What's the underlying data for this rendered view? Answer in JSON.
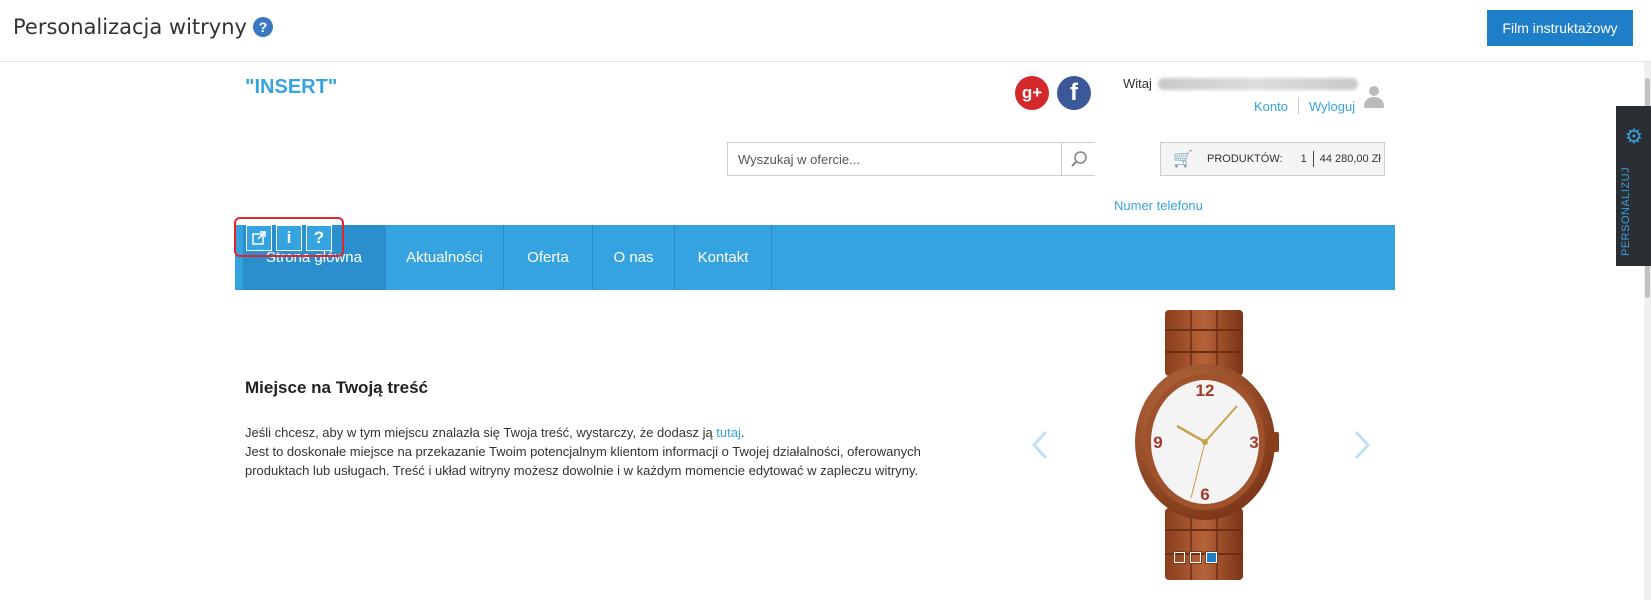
{
  "header": {
    "title": "Personalizacja witryny",
    "help_icon": "?",
    "film_button": "Film instruktażowy"
  },
  "side_panel": {
    "label": "PERSONALIZUJ",
    "icon": "gear-icon"
  },
  "shop": {
    "logo": "\"INSERT\"",
    "social": [
      "google-plus-icon",
      "facebook-icon"
    ],
    "welcome": "Witaj",
    "account_link": "Konto",
    "logout_link": "Wyloguj",
    "search_placeholder": "Wyszukaj w ofercie...",
    "cart_label": "PRODUKTÓW:",
    "cart_count": "1",
    "cart_total": "44 280,00 Zł",
    "phone_link": "Numer telefonu"
  },
  "nav": {
    "items": [
      "Strona główna",
      "Aktualności",
      "Oferta",
      "O nas",
      "Kontakt"
    ],
    "active_index": 0,
    "edit_tools": [
      "external-link-icon",
      "info-icon",
      "question-icon"
    ]
  },
  "content": {
    "title": "Miejsce na Twoją treść",
    "line1_before": "Jeśli chcesz, aby w tym miejscu znalazła się Twoja treść, wystarczy, że dodasz ją ",
    "line1_link": "tutaj",
    "line1_after": ".",
    "line2": "Jest to doskonałe miejsce na przekazanie Twoim potencjalnym klientom informacji o Twojej działalności, oferowanych produktach lub usługach. Treść i układ witryny możesz dowolnie i w każdym momencie edytować w zapleczu witryny."
  },
  "slider": {
    "dots": 3,
    "active_dot": 2
  },
  "colors": {
    "accent": "#36a3e1",
    "button": "#1e7ec8",
    "highlight": "#e0262b"
  }
}
